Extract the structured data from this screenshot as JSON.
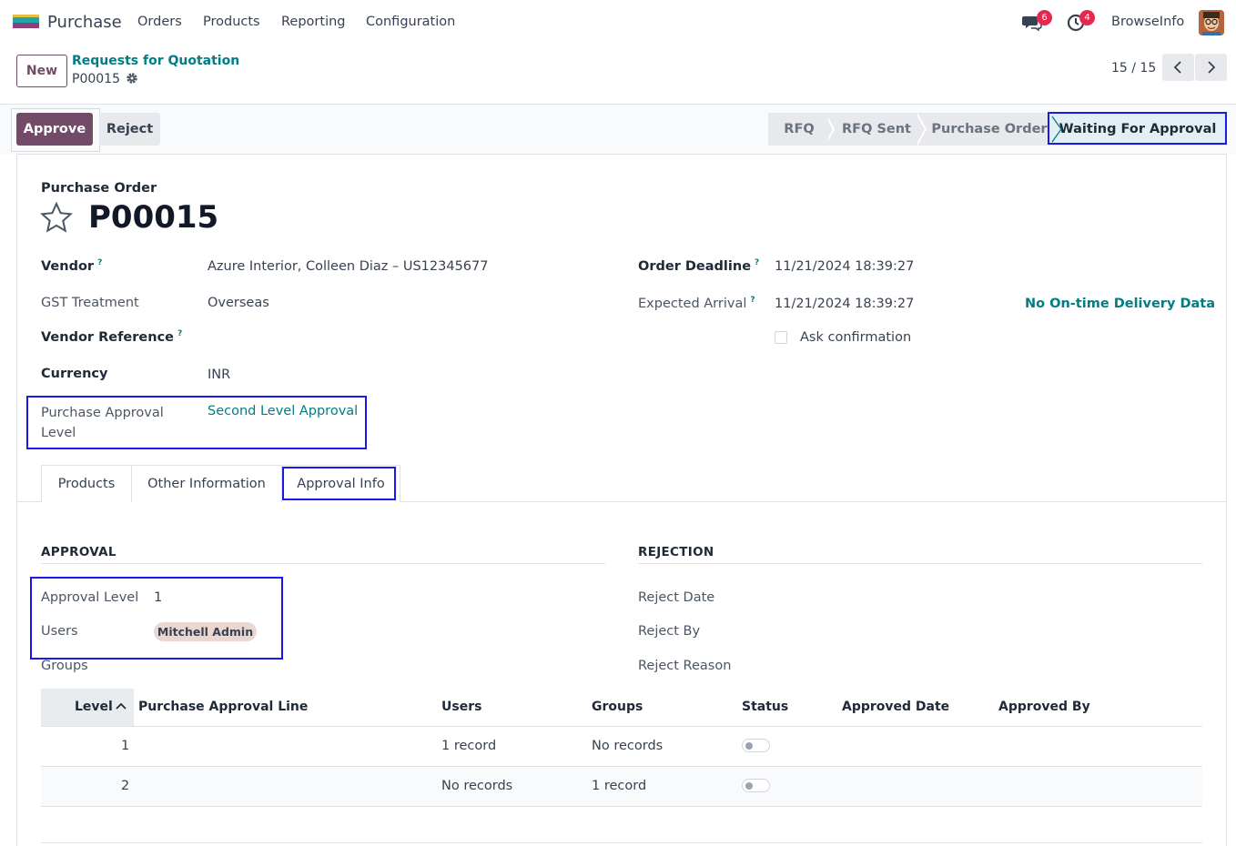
{
  "navbar": {
    "app_name": "Purchase",
    "menu": [
      "Orders",
      "Products",
      "Reporting",
      "Configuration"
    ],
    "messages_count": "6",
    "activities_count": "4",
    "user_name": "BrowseInfo"
  },
  "control_panel": {
    "new_label": "New",
    "breadcrumb": "Requests for Quotation",
    "record": "P00015",
    "pager": "15 / 15"
  },
  "statusbar": {
    "approve_label": "Approve",
    "reject_label": "Reject",
    "stages": [
      "RFQ",
      "RFQ Sent",
      "Purchase Order",
      "Waiting For Approval"
    ],
    "active_stage": "Waiting For Approval"
  },
  "form": {
    "doc_type": "Purchase Order",
    "name": "P00015",
    "vendor_label": "Vendor",
    "vendor_value": "Azure Interior, Colleen Diaz – US12345677",
    "gst_label": "GST Treatment",
    "gst_value": "Overseas",
    "vendor_ref_label": "Vendor Reference",
    "currency_label": "Currency",
    "currency_value": "INR",
    "approval_level_label_1": "Purchase Approval",
    "approval_level_label_2": "Level",
    "approval_level_value": "Second Level Approval",
    "order_deadline_label": "Order Deadline",
    "order_deadline_value": "11/21/2024 18:39:27",
    "expected_arrival_label": "Expected Arrival",
    "expected_arrival_value": "11/21/2024 18:39:27",
    "on_time_label": "No On-time Delivery Data",
    "ask_confirmation_label": "Ask confirmation",
    "help_mark": "?"
  },
  "tabs": [
    "Products",
    "Other Information",
    "Approval Info"
  ],
  "approval": {
    "title": "APPROVAL",
    "level_label": "Approval Level",
    "level_value": "1",
    "users_label": "Users",
    "users_tag": "Mitchell Admin",
    "groups_label": "Groups"
  },
  "rejection": {
    "title": "REJECTION",
    "date_label": "Reject Date",
    "by_label": "Reject By",
    "reason_label": "Reject Reason"
  },
  "table": {
    "headers": [
      "Level",
      "Purchase Approval Line",
      "Users",
      "Groups",
      "Status",
      "Approved Date",
      "Approved By"
    ],
    "rows": [
      {
        "level": "1",
        "users": "1 record",
        "groups": "No records",
        "status": false
      },
      {
        "level": "2",
        "users": "No records",
        "groups": "1 record",
        "status": false
      }
    ]
  },
  "colors": {
    "brand": "#714b67",
    "link": "#017e84",
    "highlight": "#1a1ae6",
    "badge": "#e6284f"
  }
}
